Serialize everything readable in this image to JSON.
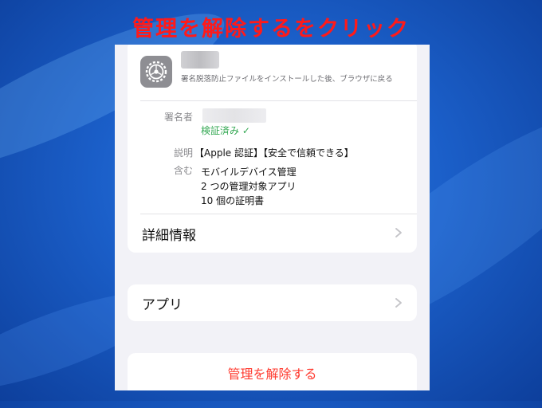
{
  "instruction": "管理を解除するをクリック",
  "profile": {
    "subtitle": "署名脱落防止ファイルをインストールした後、ブラウザに戻る"
  },
  "details": {
    "signer_label": "署名者",
    "verified_text": "検証済み ✓",
    "description_label": "説明",
    "description_value": "【Apple 認証】【安全で信頼できる】",
    "contains_label": "含む",
    "contains_items": [
      "モバイルデバイス管理",
      "2 つの管理対象アプリ",
      "10 個の証明書"
    ],
    "more_details_label": "詳細情報"
  },
  "apps_label": "アプリ",
  "remove_label": "管理を解除する",
  "colors": {
    "accent_red": "#ff3b30",
    "instruction_red": "#ff1a1a",
    "verified_green": "#34a853"
  },
  "icons": [
    "settings-gear-icon",
    "chevron-right-icon"
  ]
}
